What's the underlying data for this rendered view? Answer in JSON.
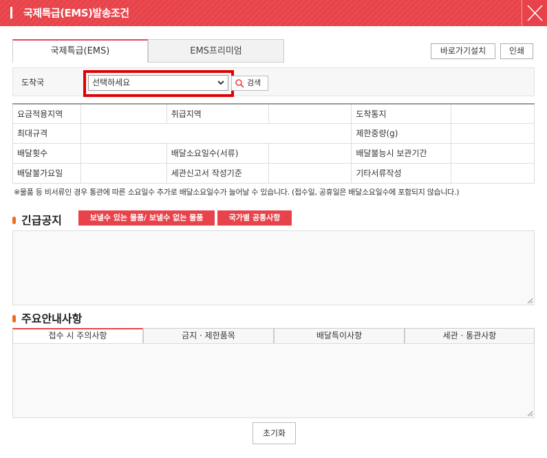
{
  "titlebar": {
    "title": "국제특급(EMS)발송조건",
    "close_icon": "close-icon"
  },
  "tabs": [
    {
      "label": "국제특급(EMS)",
      "active": true
    },
    {
      "label": "EMS프리미엄",
      "active": false
    }
  ],
  "toolbar": {
    "shortcut_label": "바로가기설치",
    "print_label": "인쇄"
  },
  "search": {
    "destination_label": "도착국",
    "select_value": "선택하세요",
    "button_label": "검색",
    "highlight_color": "#e00000"
  },
  "info_table": {
    "rows": [
      [
        "요금적용지역",
        "",
        "취급지역",
        "",
        "도착통지",
        ""
      ],
      [
        "최대규격",
        "",
        "제한중량(g)",
        ""
      ],
      [
        "배달횟수",
        "",
        "배달소요일수(서류)",
        "",
        "배달불능시 보관기간",
        ""
      ],
      [
        "배달불가요일",
        "",
        "세관신고서 작성기준",
        "",
        "기타서류작성",
        ""
      ]
    ]
  },
  "note": "※물품 등 비서류인 경우 통관에 따른 소요일수 추가로 배달소요일수가 늘어날 수 있습니다. (접수일, 공휴일은 배달소요일수에 포함되지 않습니다.)",
  "emergency": {
    "title": "긴급공지",
    "btn_items": "보낼수 있는 물품/ 보낼수 없는 물품",
    "btn_country": "국가별 공통사항"
  },
  "guide": {
    "title": "주요안내사항",
    "tabs": [
      "접수 시 주의사항",
      "금지 · 제한품목",
      "배달특이사항",
      "세관 · 통관사항"
    ]
  },
  "reset_label": "초기화",
  "colors": {
    "accent": "#e8434a",
    "bullet": "#f06a1d"
  }
}
